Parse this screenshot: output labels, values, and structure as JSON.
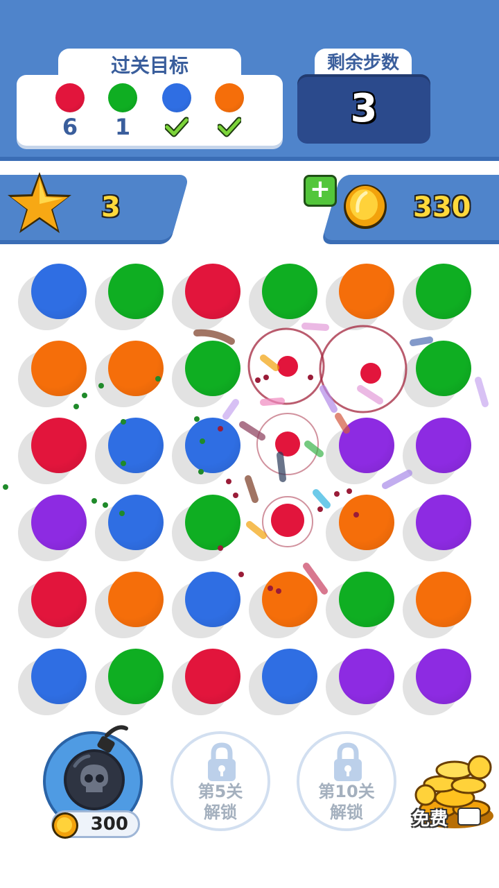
{
  "goals": {
    "title": "过关目标",
    "items": [
      {
        "color": "#e2153c",
        "count": "6",
        "done": false
      },
      {
        "color": "#0fae22",
        "count": "1",
        "done": false
      },
      {
        "color": "#2f6ee3",
        "count": "",
        "done": true
      },
      {
        "color": "#f56e0a",
        "count": "",
        "done": true
      }
    ]
  },
  "steps": {
    "title": "剩余步数",
    "value": "3"
  },
  "stars": {
    "count": "3"
  },
  "coins": {
    "plus_label": "+",
    "count": "330"
  },
  "colors": {
    "blue": "#2f6ee3",
    "green": "#0fae22",
    "red": "#e2153c",
    "orange": "#f56e0a",
    "purple": "#8d2be2",
    "header_blue": "#4f84cb"
  },
  "board": {
    "rows": [
      [
        "blue",
        "green",
        "red",
        "green",
        "orange",
        "green"
      ],
      [
        "orange",
        "orange",
        "green",
        "cleared",
        "cleared",
        "green"
      ],
      [
        "red",
        "blue",
        "blue",
        "cleared",
        "purple",
        "purple"
      ],
      [
        "purple",
        "blue",
        "green",
        "cleared",
        "orange",
        "purple"
      ],
      [
        "red",
        "orange",
        "blue",
        "orange",
        "green",
        "orange"
      ],
      [
        "blue",
        "green",
        "red",
        "blue",
        "purple",
        "purple"
      ]
    ]
  },
  "boosters": {
    "bomb": {
      "icon": "skull-bomb-icon",
      "price": "300"
    },
    "locked": [
      {
        "line1": "第5关",
        "line2": "解锁"
      },
      {
        "line1": "第10关",
        "line2": "解锁"
      }
    ],
    "free": {
      "label": "免费",
      "icon": "coin-pile-icon"
    }
  }
}
